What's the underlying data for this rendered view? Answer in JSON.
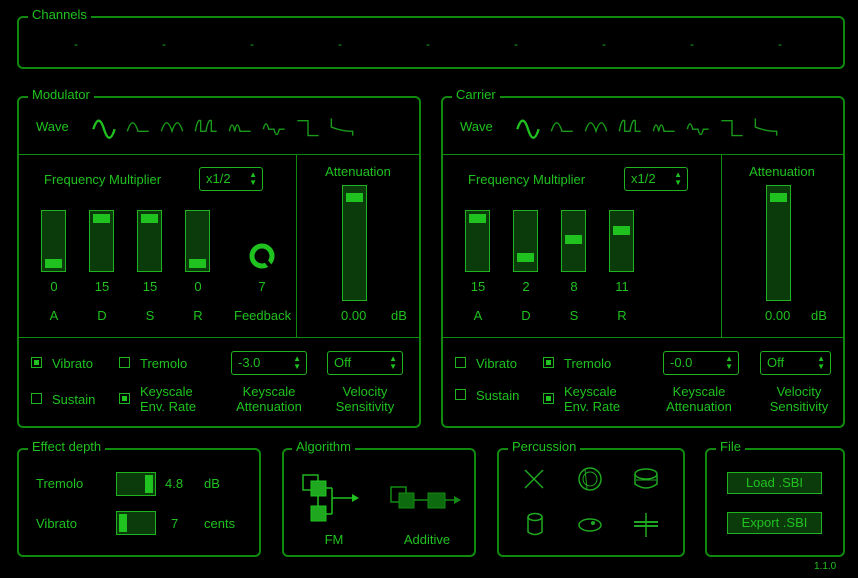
{
  "channels": {
    "title": "Channels",
    "slots": [
      "-",
      "-",
      "-",
      "-",
      "-",
      "-",
      "-",
      "-",
      "-"
    ]
  },
  "modulator": {
    "title": "Modulator",
    "wave_label": "Wave",
    "freq_label": "Frequency Multiplier",
    "freq_value": "x1/2",
    "attenuation_label": "Attenuation",
    "attenuation_value": "0.00",
    "attenuation_unit": "dB",
    "attenuation_level": 0.96,
    "adsr": [
      {
        "label": "A",
        "value": "0",
        "level": 0.0
      },
      {
        "label": "D",
        "value": "15",
        "level": 1.0
      },
      {
        "label": "S",
        "value": "15",
        "level": 1.0
      },
      {
        "label": "R",
        "value": "0",
        "level": 0.0
      }
    ],
    "feedback_value": "7",
    "feedback_label": "Feedback",
    "vibrato_label": "Vibrato",
    "vibrato_on": true,
    "tremolo_label": "Tremolo",
    "tremolo_on": false,
    "sustain_label": "Sustain",
    "sustain_on": false,
    "ksr_label_1": "Keyscale",
    "ksr_label_2": "Env. Rate",
    "ksr_on": true,
    "ksl_value": "-3.0",
    "ksl_label_1": "Keyscale",
    "ksl_label_2": "Attenuation",
    "vel_value": "Off",
    "vel_label_1": "Velocity",
    "vel_label_2": "Sensitivity"
  },
  "carrier": {
    "title": "Carrier",
    "wave_label": "Wave",
    "freq_label": "Frequency Multiplier",
    "freq_value": "x1/2",
    "attenuation_label": "Attenuation",
    "attenuation_value": "0.00",
    "attenuation_unit": "dB",
    "attenuation_level": 0.96,
    "adsr": [
      {
        "label": "A",
        "value": "15",
        "level": 1.0
      },
      {
        "label": "D",
        "value": "2",
        "level": 0.13
      },
      {
        "label": "S",
        "value": "8",
        "level": 0.53
      },
      {
        "label": "R",
        "value": "11",
        "level": 0.73
      }
    ],
    "vibrato_label": "Vibrato",
    "vibrato_on": false,
    "tremolo_label": "Tremolo",
    "tremolo_on": true,
    "sustain_label": "Sustain",
    "sustain_on": false,
    "ksr_label_1": "Keyscale",
    "ksr_label_2": "Env. Rate",
    "ksr_on": true,
    "ksl_value": "-0.0",
    "ksl_label_1": "Keyscale",
    "ksl_label_2": "Attenuation",
    "vel_value": "Off",
    "vel_label_1": "Velocity",
    "vel_label_2": "Sensitivity"
  },
  "effect_depth": {
    "title": "Effect depth",
    "tremolo": {
      "label": "Tremolo",
      "value": "4.8",
      "unit": "dB",
      "level": 1.0
    },
    "vibrato": {
      "label": "Vibrato",
      "value": "7",
      "unit": "cents",
      "level": 0.0
    }
  },
  "algorithm": {
    "title": "Algorithm",
    "fm_label": "FM",
    "additive_label": "Additive",
    "selected": "FM"
  },
  "percussion": {
    "title": "Percussion",
    "icons": [
      "off-icon",
      "bass-drum-icon",
      "snare-icon",
      "tom-icon",
      "cymbal-icon",
      "hi-hat-icon"
    ]
  },
  "file": {
    "title": "File",
    "load_label": "Load .SBI",
    "export_label": "Export .SBI"
  },
  "version": "1.1.0",
  "colors": {
    "accent": "#1fc21f",
    "border": "#0f8a0f",
    "fill": "#0b3a0b",
    "background": "#000000"
  }
}
